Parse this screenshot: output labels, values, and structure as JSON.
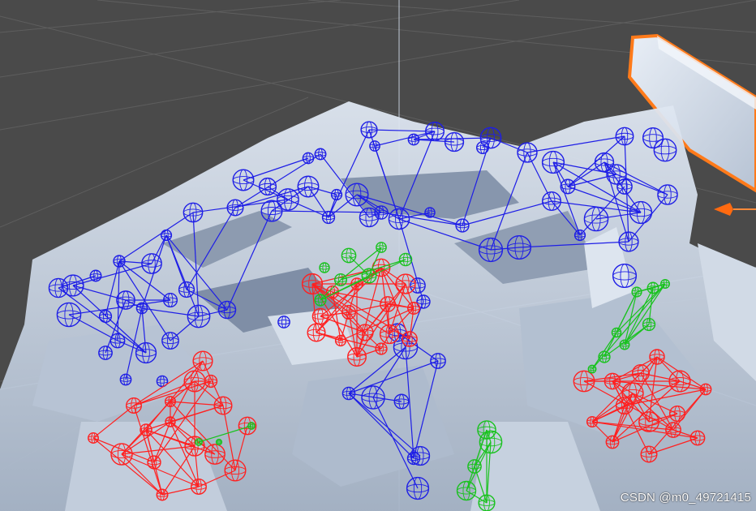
{
  "viewport": {
    "background": "#4a4a4a",
    "grid_color": "#5c5c5c",
    "axis_line_color": "#c8d0dc",
    "mesh_color": "#c9d6e6",
    "mesh_shadow": "#8e9db2",
    "selected_outline": "#ff7a1a"
  },
  "cluster_colors": {
    "blue": "#1e1ee6",
    "red": "#ff2020",
    "green": "#19c21e"
  },
  "icons": {
    "handle": "orange-arrow-handle-icon"
  },
  "watermark": {
    "text": "CSDN @m0_49721415"
  }
}
